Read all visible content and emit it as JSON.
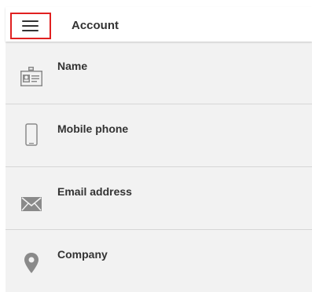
{
  "appbar": {
    "title": "Account",
    "menu_icon": "hamburger-menu-icon",
    "highlight_color": "#e02020"
  },
  "fields": [
    {
      "label": "Name",
      "icon": "id-card-icon"
    },
    {
      "label": "Mobile phone",
      "icon": "mobile-phone-icon"
    },
    {
      "label": "Email address",
      "icon": "envelope-icon"
    },
    {
      "label": "Company",
      "icon": "location-pin-icon"
    }
  ],
  "colors": {
    "background": "#f2f2f2",
    "appbar": "#ffffff",
    "text": "#333333",
    "icon": "#8a8a8a",
    "divider": "#d6d6d6"
  }
}
